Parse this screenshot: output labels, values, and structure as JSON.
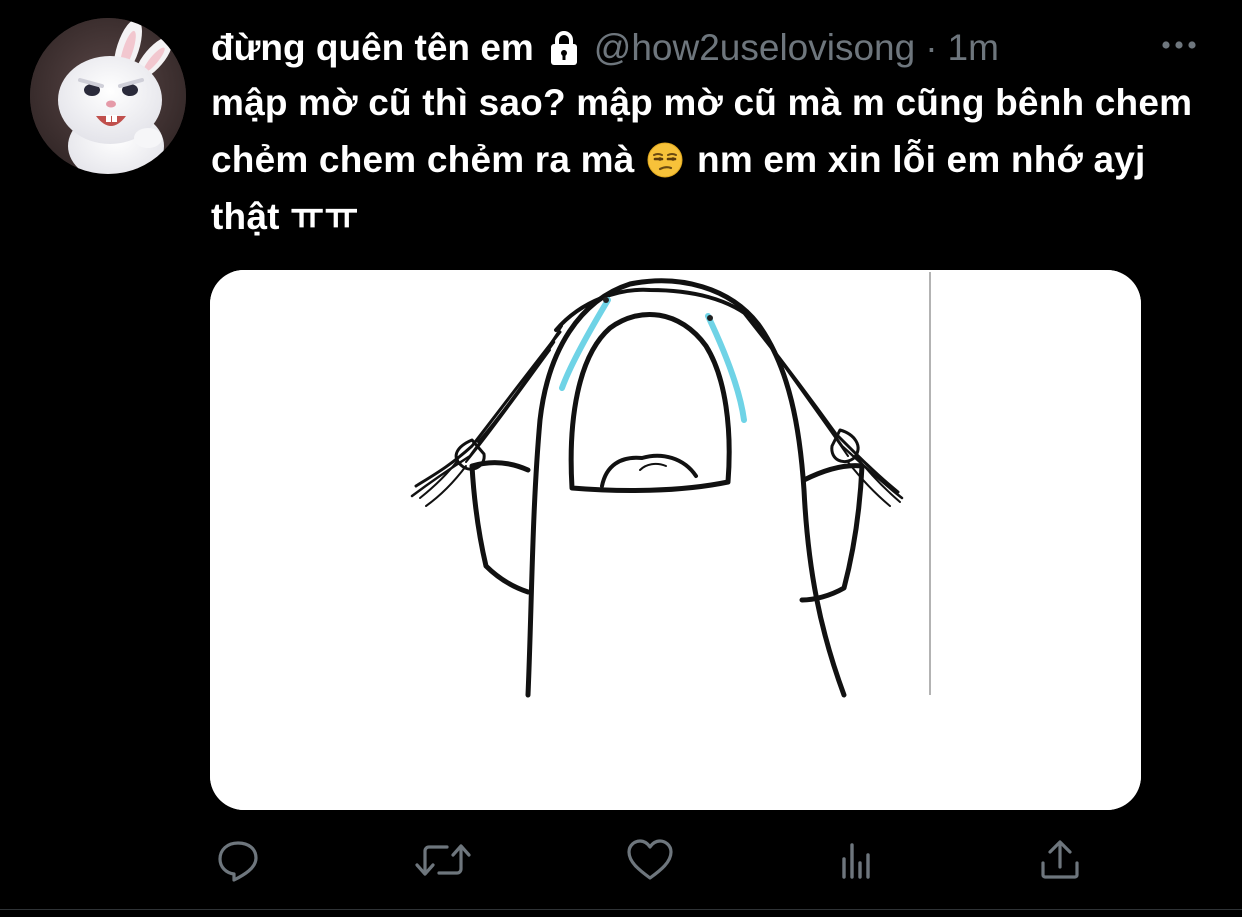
{
  "author": {
    "display_name": "đừng quên tên em",
    "handle": "@how2uselovisong",
    "separator": "·",
    "time": "1m",
    "protected_icon": "lock-icon",
    "avatar_icon": "white-rabbit-avatar"
  },
  "tweet": {
    "text_part1": "mập mờ cũ thì sao? mập mờ cũ mà m cũng bênh chem chẻm chem chẻm ra mà",
    "emoji": "unamused-face-emoji",
    "text_part2": "nm em xin lỗi em nhớ ayj thật ㅠㅠ"
  },
  "media": {
    "description_icon": "crying-cartoon-drawing"
  },
  "actions": [
    {
      "name": "reply",
      "icon": "reply-icon"
    },
    {
      "name": "retweet",
      "icon": "retweet-icon"
    },
    {
      "name": "like",
      "icon": "like-icon"
    },
    {
      "name": "analytics",
      "icon": "analytics-icon"
    },
    {
      "name": "share",
      "icon": "share-icon"
    }
  ],
  "colors": {
    "background": "#000000",
    "text_primary": "#ffffff",
    "text_secondary": "#6e767d",
    "tear_blue": "#6fd3e6"
  }
}
